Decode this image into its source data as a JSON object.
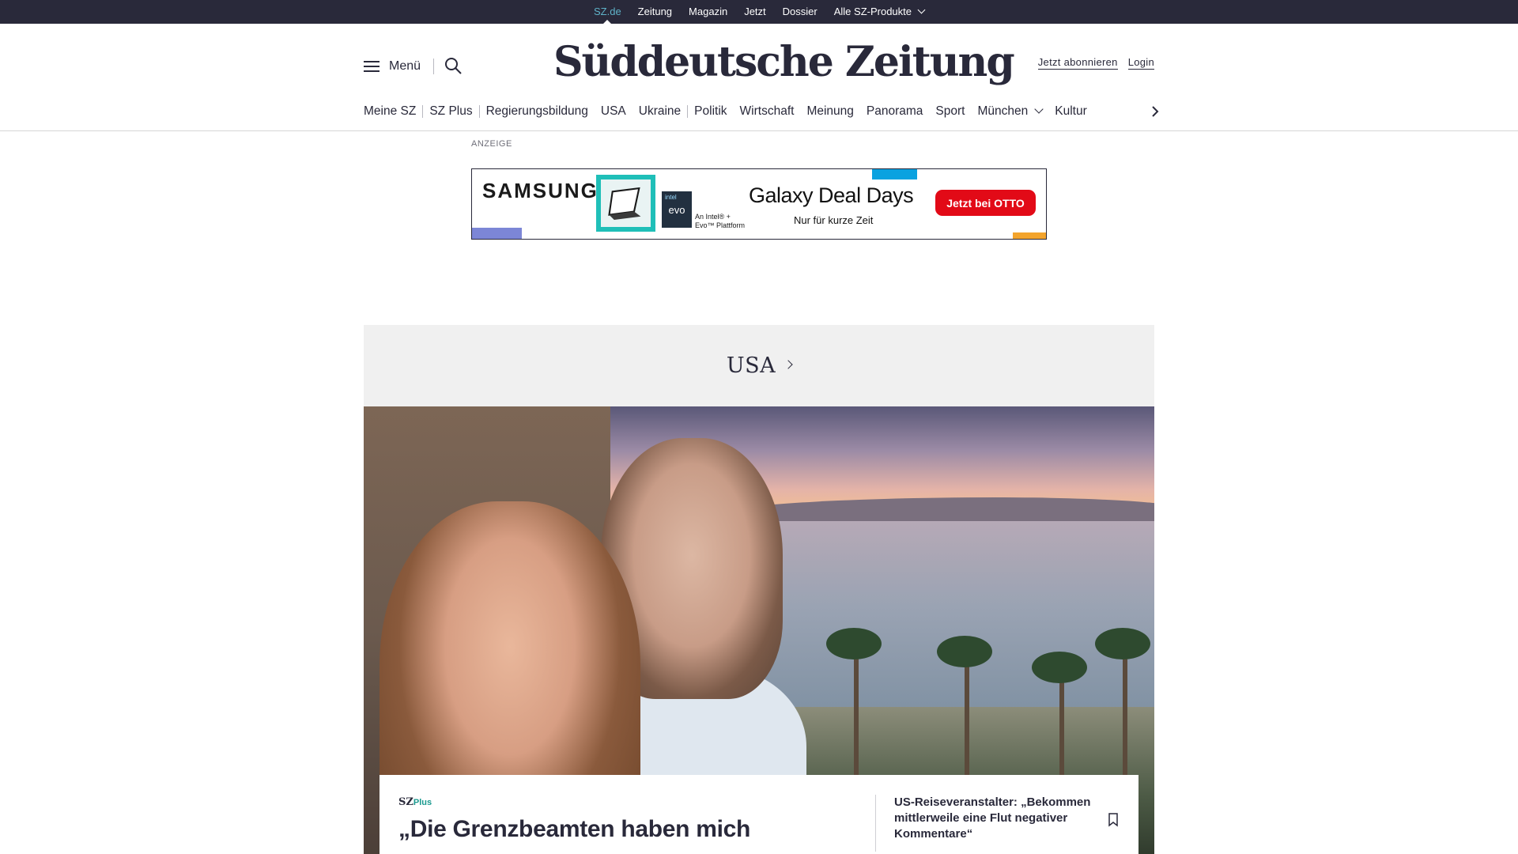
{
  "topbar": {
    "items": [
      {
        "label": "SZ.de",
        "active": true
      },
      {
        "label": "Zeitung"
      },
      {
        "label": "Magazin"
      },
      {
        "label": "Jetzt"
      },
      {
        "label": "Dossier"
      },
      {
        "label": "Alle SZ-Produkte",
        "has_dropdown": true
      }
    ],
    "active_color": "#5fb2c8",
    "background": "#29293a"
  },
  "header": {
    "menu_label": "Menü",
    "logo_text": "Süddeutsche Zeitung",
    "subscribe_label": "Jetzt abonnieren",
    "login_label": "Login"
  },
  "mainnav": {
    "items": [
      "Meine SZ",
      "SZ Plus",
      "Regierungsbildung",
      "USA",
      "Ukraine",
      "Politik",
      "Wirtschaft",
      "Meinung",
      "Panorama",
      "Sport",
      "München",
      "Kultur"
    ]
  },
  "ad": {
    "label": "ANZEIGE",
    "brand": "SAMSUNG",
    "evo_tag": "intel",
    "evo_text": "evo",
    "evo_note_1": "An Intel® +",
    "evo_note_2": "Evo™ Plattform",
    "headline": "Galaxy Deal Days",
    "subline": "Nur für kurze Zeit",
    "cta": "Jetzt bei OTTO",
    "cta_color": "#e20a17"
  },
  "section": {
    "title": "USA"
  },
  "lead_article": {
    "badge_sz": "SZ",
    "badge_plus": "Plus",
    "title": "„Die Grenzbeamten haben mich",
    "side_teaser": "US-Reiseveranstalter: „Bekommen mittlerweile eine Flut negativer Kommentare“",
    "plus_color": "#1a9a8f"
  }
}
